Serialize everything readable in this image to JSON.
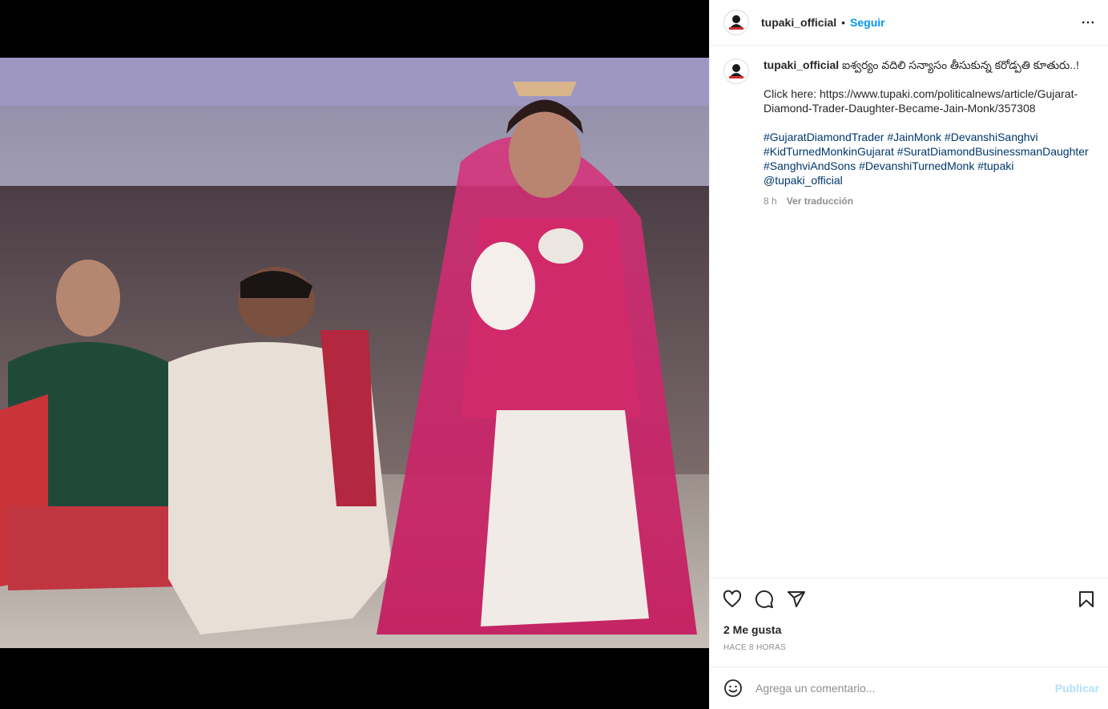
{
  "post": {
    "username": "tupaki_official",
    "follow_label": "Seguir",
    "separator": "•"
  },
  "caption": {
    "username": "tupaki_official",
    "title": "ఐశ్వర్యం వదిలి సన్యాసం తీసుకున్న కరోడ్పతి కూతురు..!",
    "link_line": "Click here: https://www.tupaki.com/politicalnews/article/Gujarat-Diamond-Trader-Daughter-Became-Jain-Monk/357308",
    "hashtags_line": "#GujaratDiamondTrader #JainMonk #DevanshiSanghvi #KidTurnedMonkinGujarat #SuratDiamondBusinessmanDaughter #SanghviAndSons #DevanshiTurnedMonk #tupaki",
    "mention": "@tupaki_official",
    "age": "8 h",
    "translate_label": "Ver traducción"
  },
  "actions": {
    "likes": "2 Me gusta",
    "timestamp": "HACE 8 HORAS"
  },
  "comment": {
    "placeholder": "Agrega un comentario...",
    "publish_label": "Publicar"
  },
  "icons": {
    "more": "more-horizontal-icon",
    "like": "heart-icon",
    "comment": "comment-icon",
    "share": "share-icon",
    "save": "bookmark-icon",
    "emoji": "emoji-icon"
  },
  "colors": {
    "accent": "#0095f6",
    "hashtag": "#00376b",
    "muted": "#8e8e8e",
    "publish_disabled": "#b2dffc"
  }
}
